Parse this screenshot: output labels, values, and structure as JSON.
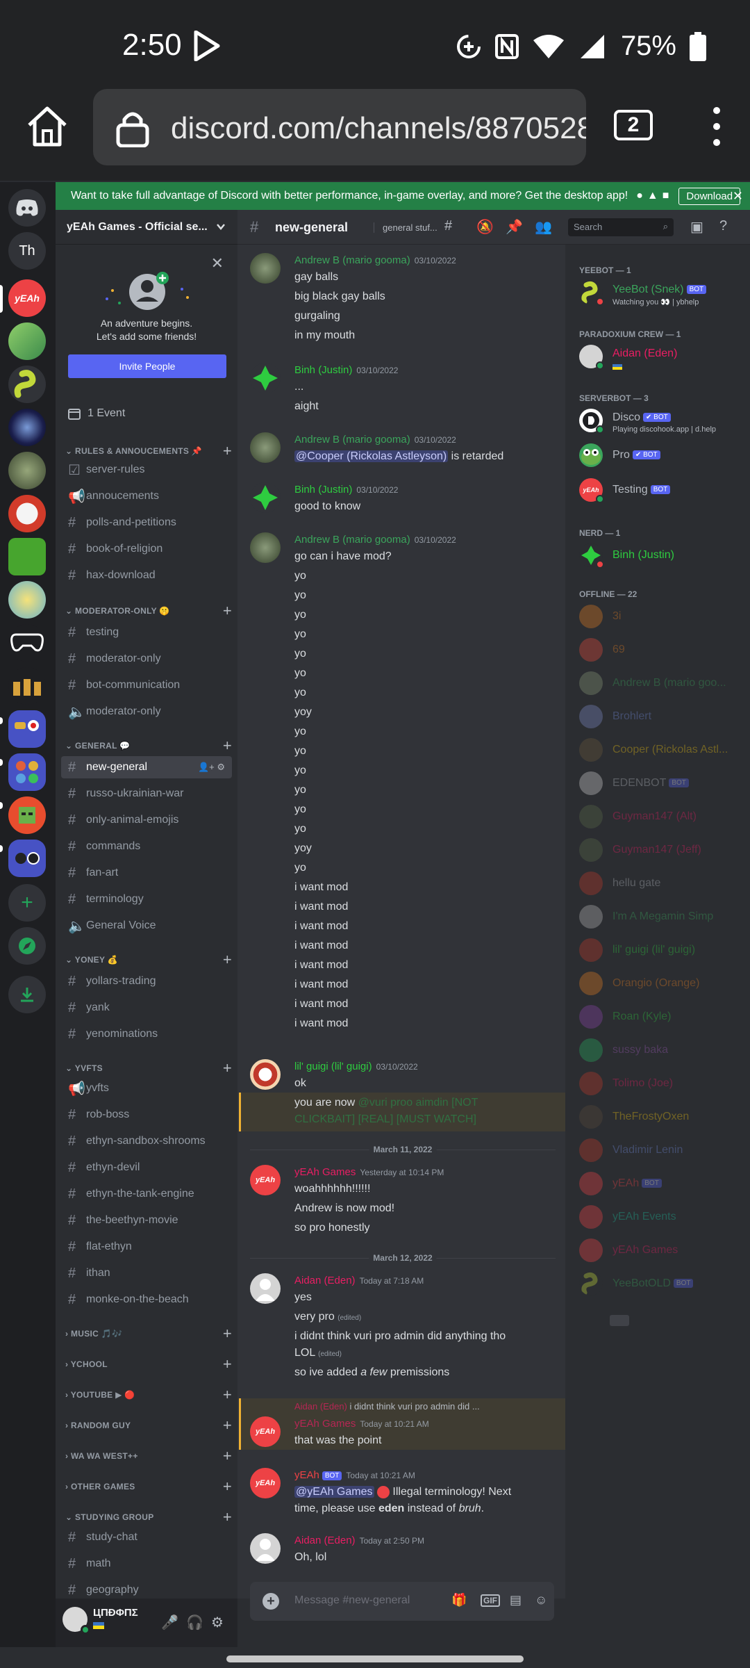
{
  "status": {
    "time": "2:50",
    "battery": "75%"
  },
  "browser": {
    "url": "discord.com/channels/8870528",
    "tab_count": "2"
  },
  "banner": {
    "text": "Want to take full advantage of Discord with better performance, in-game overlay, and more? Get the desktop app!",
    "download": "Download",
    "close": "✕"
  },
  "rail": {
    "dm_text": "Th"
  },
  "server": {
    "name": "yEAh Games - Official se...",
    "invite_text": "An adventure begins.\nLet's add some friends!",
    "invite_button": "Invite People",
    "events": "1 Event"
  },
  "channels": {
    "cat_rules": "RULES & ANNOUCEMENTS 📌",
    "server_rules": "server-rules",
    "annoucements": "annoucements",
    "polls": "polls-and-petitions",
    "religion": "book-of-religion",
    "hax": "hax-download",
    "cat_mod": "MODERATOR-ONLY 🤫",
    "testing": "testing",
    "moderator_only": "moderator-only",
    "bot_comm": "bot-communication",
    "moderator_only_voice": "moderator-only",
    "cat_general": "GENERAL 💬",
    "new_general": "new-general",
    "war": "russo-ukrainian-war",
    "emojis": "only-animal-emojis",
    "commands": "commands",
    "fanart": "fan-art",
    "terminology": "terminology",
    "general_voice": "General Voice",
    "cat_yoney": "YONEY 💰",
    "yollars": "yollars-trading",
    "yank": "yank",
    "yenominations": "yenominations",
    "cat_yvfts": "YVFTS",
    "yvfts": "yvfts",
    "rob_boss": "rob-boss",
    "ethyn_shrooms": "ethyn-sandbox-shrooms",
    "ethyn_devil": "ethyn-devil",
    "ethyn_tank": "ethyn-the-tank-engine",
    "beethyn": "the-beethyn-movie",
    "flat_ethyn": "flat-ethyn",
    "ithan": "ithan",
    "monke": "monke-on-the-beach",
    "cat_music": "MUSIC 🎵🎶",
    "cat_ychool": "YCHOOL",
    "cat_youtube": "YOUTUBE ▶ 🔴",
    "cat_random": "RANDOM GUY",
    "cat_wawa": "WA WA WEST++",
    "cat_other": "OTHER GAMES",
    "cat_study": "STUDYING GROUP",
    "study_chat": "study-chat",
    "math": "math",
    "geography": "geography"
  },
  "user": {
    "name": "ЦПÐΦПΣ"
  },
  "header": {
    "channel": "new-general",
    "topic": "general stuf...",
    "search_placeholder": "Search"
  },
  "messages": {
    "m1": {
      "author": "Andrew B (mario gooma)",
      "ts": "03/10/2022",
      "l1": "gay balls",
      "l2": "big black gay balls",
      "l3": "gurgaling",
      "l4": "in my mouth"
    },
    "m2": {
      "author": "Binh (Justin)",
      "ts": "03/10/2022",
      "l1": "...",
      "l2": "aight"
    },
    "m3": {
      "author": "Andrew B (mario gooma)",
      "ts": "03/10/2022",
      "mention": "@Cooper (Rickolas Astleyson)",
      "rest": " is retarded"
    },
    "m4": {
      "author": "Binh (Justin)",
      "ts": "03/10/2022",
      "l1": "good to know"
    },
    "m5": {
      "author": "Andrew B (mario gooma)",
      "ts": "03/10/2022",
      "l1": "go can i have mod?",
      "yo": "yo",
      "yoy": "yoy",
      "want": "i want mod"
    },
    "m6": {
      "author": "lil' guigi (lil' guigi)",
      "ts": "03/10/2022",
      "l1": "ok",
      "l2a": "you are now ",
      "l2b": "@vuri proo aimdin [NOT",
      "l3": "CLICKBAIT] [REAL] [MUST WATCH]"
    },
    "d1": "March 11, 2022",
    "m7": {
      "author": "yEAh Games",
      "ts": "Yesterday at 10:14 PM",
      "l1": "woahhhhhh!!!!!!",
      "l2": "Andrew is now mod!",
      "l3": "so pro honestly"
    },
    "d2": "March 12, 2022",
    "m8": {
      "author": "Aidan (Eden)",
      "ts": "Today at 7:18 AM",
      "l1": "yes",
      "l2": "very pro",
      "edited": "(edited)",
      "l3": "i didnt think vuri pro admin did anything tho",
      "l4": "LOL",
      "l5a": "so ive added ",
      "l5b": "a few",
      "l5c": " premissions"
    },
    "m9": {
      "reply_author": "Aidan (Eden)",
      "reply_text": "i didnt think vuri pro admin did ...",
      "author": "yEAh Games",
      "ts": "Today at 10:21 AM",
      "l1": "that was the point"
    },
    "m10": {
      "author": "yEAh",
      "bot": "BOT",
      "ts": "Today at 10:21 AM",
      "mention": "@yEAh Games",
      "l1b": " Illegal terminology! Next",
      "l2a": "time, please use ",
      "l2b": "eden",
      "l2c": " instead of ",
      "l2d": "bruh",
      "l2e": "."
    },
    "m11": {
      "author": "Aidan (Eden)",
      "ts": "Today at 2:50 PM",
      "l1": "Oh, lol"
    }
  },
  "composer": {
    "placeholder": "Message #new-general"
  },
  "members": {
    "g1": "YEEBOT — 1",
    "yeebot": "YeeBot (Snek)",
    "yeebot_sub": "Watching you 👀 | ybhelp",
    "g2": "PARADOXIUM CREW — 1",
    "aidan": "Aidan (Eden)",
    "g3": "SERVERBOT — 3",
    "disco": "Disco",
    "disco_sub": "Playing discohook.app | d.help",
    "pro": "Pro",
    "testing": "Testing",
    "g4": "NERD — 1",
    "binh": "Binh (Justin)",
    "g5": "OFFLINE — 22",
    "o1": "3i",
    "o2": "69",
    "o3": "Andrew B (mario goo...",
    "o4": "Brohlert",
    "o5": "Cooper (Rickolas Astl...",
    "o6": "EDENBOT",
    "o7": "Guyman147 (Alt)",
    "o8": "Guyman147 (Jeff)",
    "o9": "hellu gate",
    "o10": "I'm A Megamin Simp",
    "o11": "lil' guigi (lil' guigi)",
    "o12": "Orangio (Orange)",
    "o13": "Roan (Kyle)",
    "o14": "sussy baka",
    "o15": "Tolimo (Joe)",
    "o16": "TheFrostyOxen",
    "o17": "Vladimir Lenin",
    "o18": "yEAh",
    "o19": "yEAh Events",
    "o20": "yEAh Games",
    "o21": "YeeBotOLD",
    "bot": "BOT",
    "verified_bot": "✔ BOT"
  },
  "colors": {
    "accent": "#5865f2",
    "green": "#23a55a",
    "banner": "#248046",
    "mention_bg": "#3c4270"
  }
}
